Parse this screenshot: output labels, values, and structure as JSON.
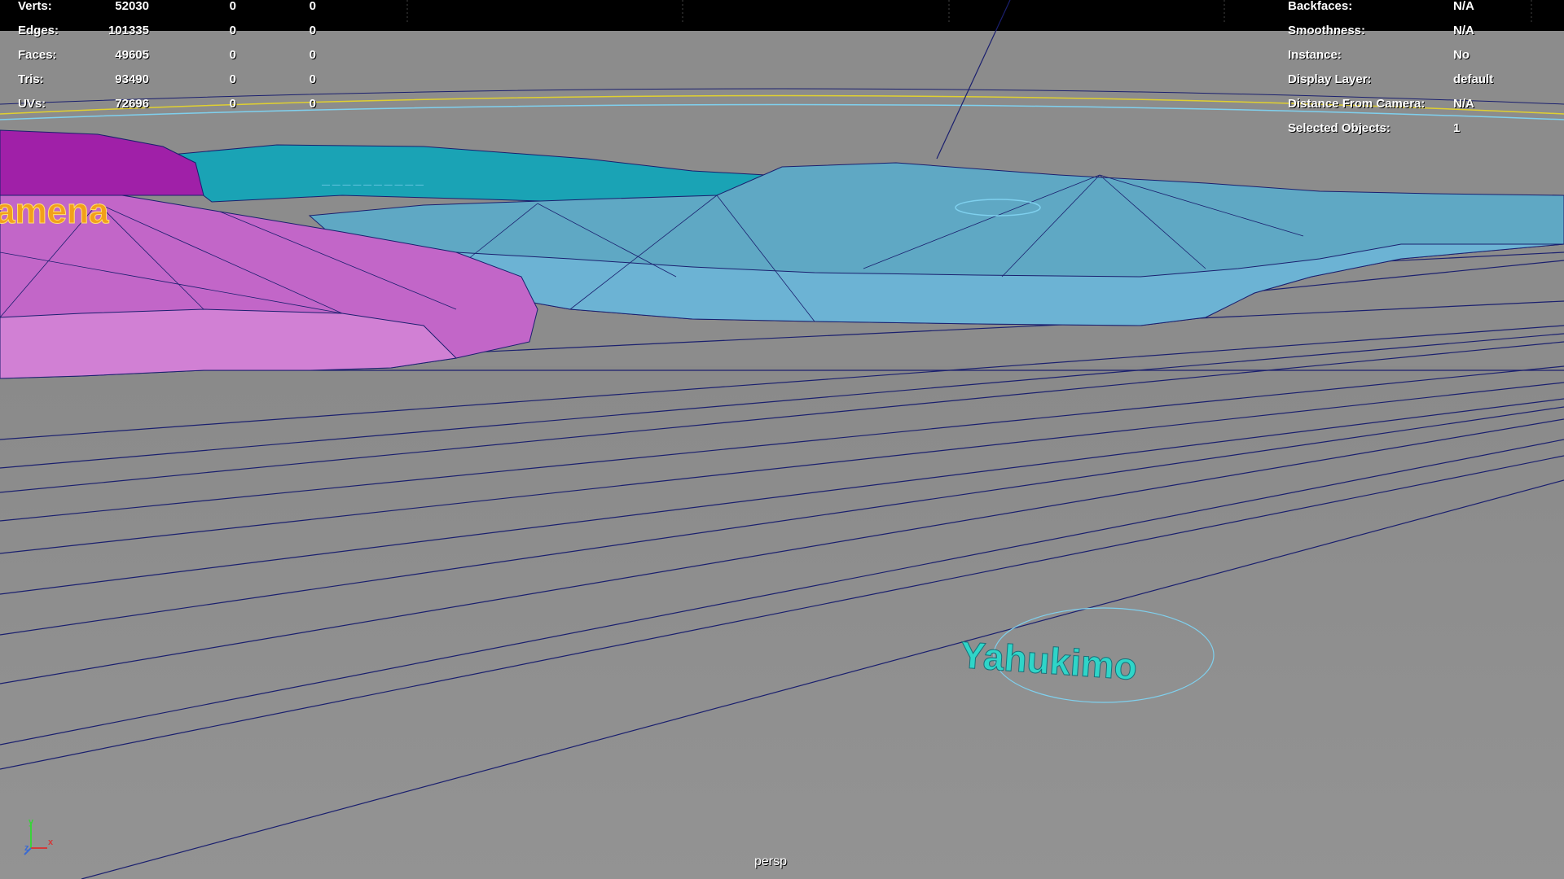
{
  "viewport": {
    "camera_name": "persp",
    "background_color": "#8d8d8d",
    "wire_color": "#1a1f6e"
  },
  "hud_left": {
    "rows": [
      {
        "label": "Verts:",
        "value": "52030",
        "sel": "0",
        "comp": "0"
      },
      {
        "label": "Edges:",
        "value": "101335",
        "sel": "0",
        "comp": "0"
      },
      {
        "label": "Faces:",
        "value": "49605",
        "sel": "0",
        "comp": "0"
      },
      {
        "label": "Tris:",
        "value": "93490",
        "sel": "0",
        "comp": "0"
      },
      {
        "label": "UVs:",
        "value": "72696",
        "sel": "0",
        "comp": "0"
      }
    ]
  },
  "hud_right": {
    "rows": [
      {
        "label": "Backfaces:",
        "value": "N/A"
      },
      {
        "label": "Smoothness:",
        "value": "N/A"
      },
      {
        "label": "Instance:",
        "value": "No"
      },
      {
        "label": "Display Layer:",
        "value": "default"
      },
      {
        "label": "Distance From Camera:",
        "value": "N/A"
      },
      {
        "label": "Selected Objects:",
        "value": "1"
      }
    ]
  },
  "scene_labels": {
    "region_label_left": "amena",
    "region_label_selected": "Yahukimo"
  },
  "axis_gizmo": {
    "x": "x",
    "y": "y",
    "z": "z"
  },
  "colors": {
    "magenta_region": "#c266c8",
    "magenta_dark": "#a020a8",
    "teal_region": "#1aa3b5",
    "light_blue_region": "#5fa8c4",
    "selected_text": "#2fd5c8",
    "highlight_yellow": "#e0d030",
    "highlight_cyan": "#7fd0ee",
    "label_orange": "#f2a01a"
  }
}
